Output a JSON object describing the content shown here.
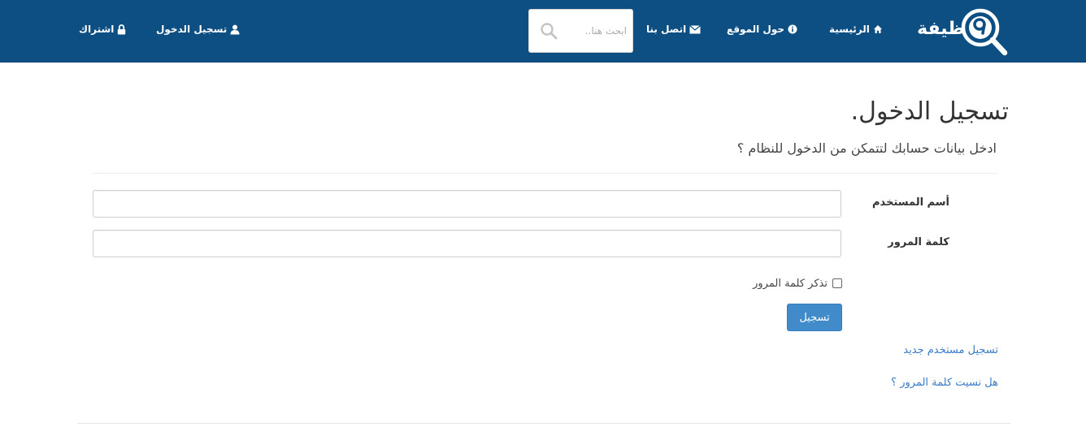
{
  "navbar": {
    "brand": "ظيفة",
    "brand_logo": "magnifier-logo",
    "items": [
      {
        "label": "الرئيسية",
        "icon": "home-icon"
      },
      {
        "label": "حول الموقع",
        "icon": "info-circle-icon"
      },
      {
        "label": "اتصل بنا",
        "icon": "envelope-icon"
      },
      {
        "label": "تسجيل الدخول",
        "icon": "user-icon"
      },
      {
        "label": "اشتراك",
        "icon": "lock-icon"
      }
    ],
    "search": {
      "placeholder": "ابحث هنا..",
      "value": "",
      "icon": "search-icon"
    },
    "colors": {
      "bar": "#0d4f83",
      "text": "#ffffff"
    }
  },
  "login": {
    "title": "تسجيل الدخول.",
    "subtitle": "ادخل بيانات حسابك لتتمكن من الدخول للنظام ؟",
    "username_label": "أسم المستخدم",
    "username_value": "",
    "password_label": "كلمة المرور",
    "password_value": "",
    "remember_label": "تذكر كلمة المرور",
    "remember_checked": false,
    "submit_label": "تسجيل",
    "register_link": "تسجيل مستخدم جديد",
    "forgot_link": "هل نسيت كلمة المرور ؟",
    "colors": {
      "button": "#428bca",
      "link": "#3a7cc7"
    }
  }
}
